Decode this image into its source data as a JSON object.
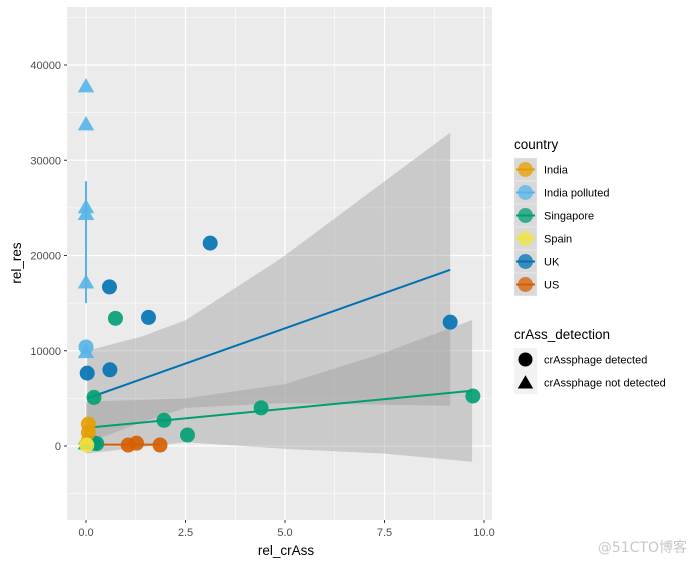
{
  "chart_data": {
    "type": "scatter",
    "title": "",
    "xlabel": "rel_crAss",
    "ylabel": "rel_res",
    "xlim": [
      -0.45,
      10.2
    ],
    "ylim": [
      -7700,
      46000
    ],
    "x_ticks": [
      0,
      2.5,
      5,
      7.5,
      10
    ],
    "x_tick_labels": [
      "0.0",
      "2.5",
      "5.0",
      "7.5",
      "10.0"
    ],
    "y_ticks": [
      0,
      10000,
      20000,
      30000,
      40000
    ],
    "y_tick_labels": [
      "0",
      "10000",
      "20000",
      "30000",
      "40000"
    ],
    "grid": true,
    "legend_position": "right",
    "legends": [
      {
        "title": "country",
        "entries": [
          {
            "label": "India",
            "color": "#E69F00"
          },
          {
            "label": "India polluted",
            "color": "#56B4E9"
          },
          {
            "label": "Singapore",
            "color": "#009E73"
          },
          {
            "label": "Spain",
            "color": "#F0E442"
          },
          {
            "label": "UK",
            "color": "#0072B2"
          },
          {
            "label": "US",
            "color": "#D55E00"
          }
        ]
      },
      {
        "title": "crAss_detection",
        "entries": [
          {
            "label": "crAssphage detected",
            "shape": "circle"
          },
          {
            "label": "crAssphage not detected",
            "shape": "triangle"
          }
        ]
      }
    ],
    "series": [
      {
        "name": "India polluted",
        "color": "#56B4E9",
        "points": [
          {
            "x": 0,
            "y": 37700,
            "shape": "triangle"
          },
          {
            "x": 0,
            "y": 33700,
            "shape": "triangle"
          },
          {
            "x": 0,
            "y": 25000,
            "shape": "triangle"
          },
          {
            "x": 0,
            "y": 24300,
            "shape": "triangle"
          },
          {
            "x": 0,
            "y": 17100,
            "shape": "triangle"
          },
          {
            "x": 0,
            "y": 10400,
            "shape": "circle"
          },
          {
            "x": 0,
            "y": 9800,
            "shape": "triangle"
          }
        ],
        "fit": {
          "x": [
            0,
            0
          ],
          "y": [
            15000,
            27800
          ]
        }
      },
      {
        "name": "UK",
        "color": "#0072B2",
        "points": [
          {
            "x": 3.12,
            "y": 21300,
            "shape": "circle"
          },
          {
            "x": 0.59,
            "y": 16700,
            "shape": "circle"
          },
          {
            "x": 1.57,
            "y": 13500,
            "shape": "circle"
          },
          {
            "x": 0.03,
            "y": 7650,
            "shape": "circle"
          },
          {
            "x": 0.6,
            "y": 8000,
            "shape": "circle"
          },
          {
            "x": 9.15,
            "y": 13000,
            "shape": "circle"
          },
          {
            "x": 0.2,
            "y": 300,
            "shape": "circle"
          }
        ],
        "fit": {
          "x": [
            0.03,
            9.15
          ],
          "y": [
            5000,
            18500
          ]
        },
        "band": {
          "x": [
            0.03,
            1.4,
            2.5,
            4.9,
            9.15
          ],
          "upper": [
            10000,
            11500,
            13200,
            19700,
            32900
          ],
          "lower": [
            300,
            2500,
            4000,
            4500,
            4230
          ]
        }
      },
      {
        "name": "Singapore",
        "color": "#009E73",
        "points": [
          {
            "x": 0.74,
            "y": 13400,
            "shape": "circle"
          },
          {
            "x": 0.2,
            "y": 5100,
            "shape": "circle"
          },
          {
            "x": 1.96,
            "y": 2700,
            "shape": "circle"
          },
          {
            "x": 2.55,
            "y": 1150,
            "shape": "circle"
          },
          {
            "x": 4.4,
            "y": 4000,
            "shape": "circle"
          },
          {
            "x": 9.72,
            "y": 5250,
            "shape": "circle"
          },
          {
            "x": 0.27,
            "y": 250,
            "shape": "circle"
          },
          {
            "x": 0,
            "y": 200,
            "shape": "triangle"
          }
        ],
        "fit": {
          "x": [
            0,
            9.7
          ],
          "y": [
            1900,
            5800
          ]
        },
        "band": {
          "x": [
            0,
            2.5,
            5,
            7.5,
            9.7
          ],
          "upper": [
            4650,
            5000,
            6500,
            9800,
            13230
          ],
          "lower": [
            -800,
            400,
            -300,
            -800,
            -1650
          ]
        }
      },
      {
        "name": "India",
        "color": "#E69F00",
        "points": [
          {
            "x": 0.06,
            "y": 2300,
            "shape": "circle"
          },
          {
            "x": 0.06,
            "y": 1400,
            "shape": "circle"
          },
          {
            "x": 0,
            "y": 700,
            "shape": "triangle"
          }
        ],
        "fit": null
      },
      {
        "name": "Spain",
        "color": "#F0E442",
        "points": [
          {
            "x": 0.02,
            "y": 100,
            "shape": "circle"
          }
        ],
        "fit": null
      },
      {
        "name": "US",
        "color": "#D55E00",
        "points": [
          {
            "x": 1.06,
            "y": 100,
            "shape": "circle"
          },
          {
            "x": 1.27,
            "y": 300,
            "shape": "circle"
          },
          {
            "x": 1.86,
            "y": 100,
            "shape": "circle"
          }
        ],
        "fit": {
          "x": [
            0,
            1.86
          ],
          "y": [
            150,
            150
          ]
        }
      }
    ]
  },
  "watermark": "@51CTO博客"
}
